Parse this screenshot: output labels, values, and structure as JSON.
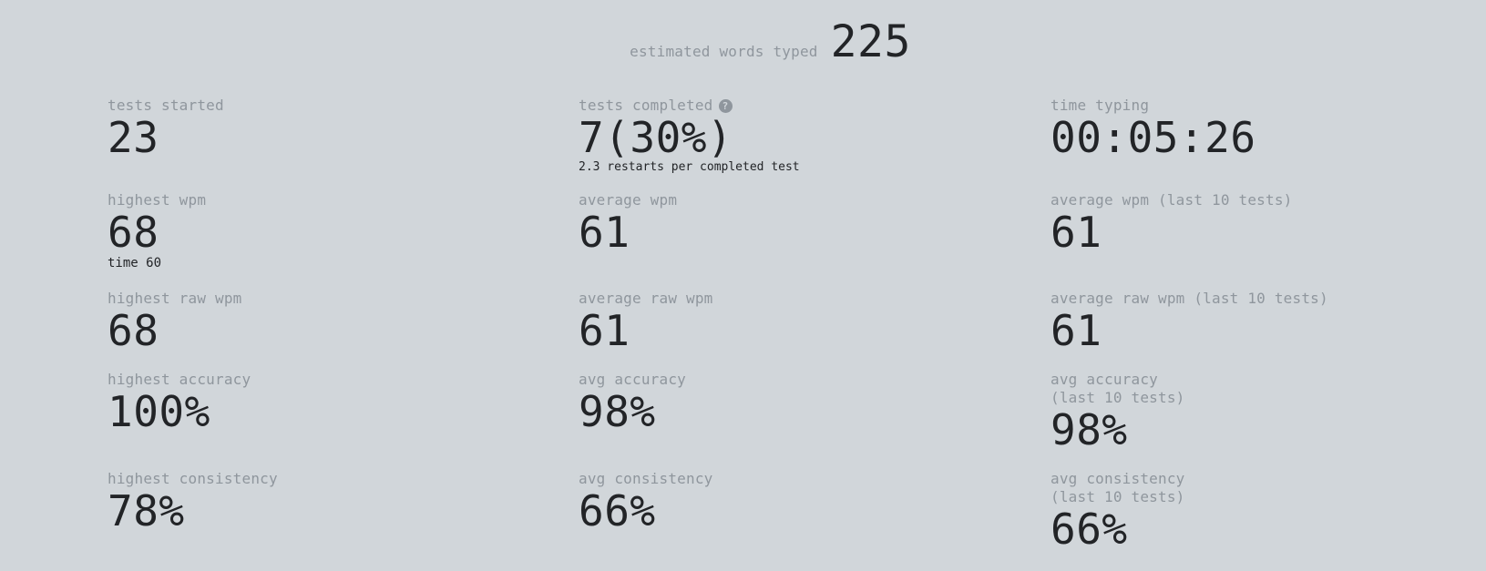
{
  "summary": {
    "words_label": "estimated words typed",
    "words_value": "225"
  },
  "stats": {
    "tests_started": {
      "label": "tests started",
      "value": "23"
    },
    "tests_completed": {
      "label": "tests completed",
      "value": "7(30%)",
      "note": "2.3 restarts per completed test"
    },
    "time_typing": {
      "label": "time typing",
      "value": "00:05:26"
    },
    "highest_wpm": {
      "label": "highest wpm",
      "value": "68",
      "note": "time 60"
    },
    "average_wpm": {
      "label": "average wpm",
      "value": "61"
    },
    "average_wpm_last10": {
      "label": "average wpm (last 10 tests)",
      "value": "61"
    },
    "highest_raw_wpm": {
      "label": "highest raw wpm",
      "value": "68"
    },
    "average_raw_wpm": {
      "label": "average raw wpm",
      "value": "61"
    },
    "average_raw_wpm_last10": {
      "label": "average raw wpm (last 10 tests)",
      "value": "61"
    },
    "highest_accuracy": {
      "label": "highest accuracy",
      "value": "100%"
    },
    "avg_accuracy": {
      "label": "avg accuracy",
      "value": "98%"
    },
    "avg_accuracy_last10": {
      "label_line1": "avg accuracy",
      "label_line2": "(last 10 tests)",
      "value": "98%"
    },
    "highest_consistency": {
      "label": "highest consistency",
      "value": "78%"
    },
    "avg_consistency": {
      "label": "avg consistency",
      "value": "66%"
    },
    "avg_consistency_last10": {
      "label_line1": "avg consistency",
      "label_line2": "(last 10 tests)",
      "value": "66%"
    }
  },
  "icons": {
    "help": "question-circle-icon"
  },
  "colors": {
    "background": "#d1d6da",
    "label": "#8f969d",
    "text": "#222427"
  }
}
